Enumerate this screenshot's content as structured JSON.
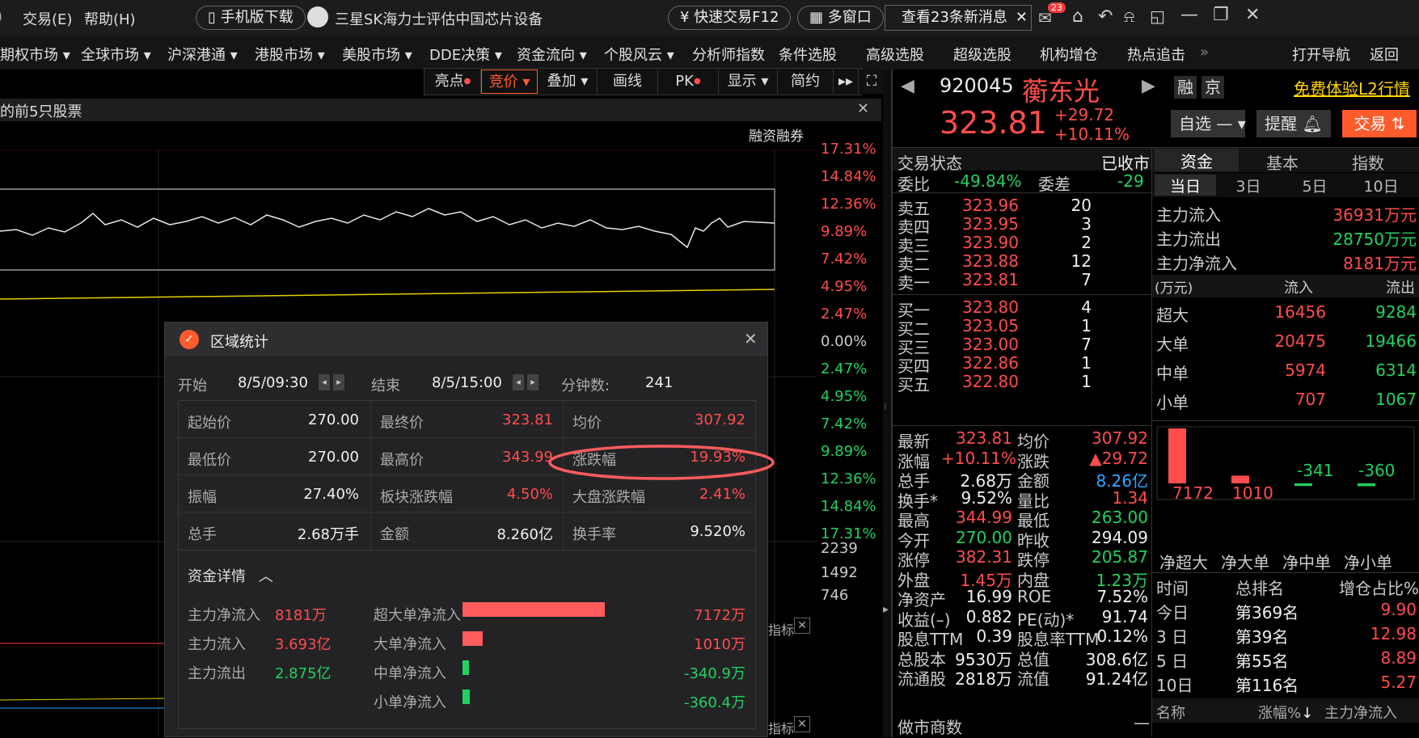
{
  "titlebar": {
    "menu_trade": "交易(E)",
    "menu_help": "帮助(H)",
    "mobile_download": "手机版下载",
    "news_headline": "三星SK海力士评估中国芯片设备",
    "quick_trade": "快速交易F12",
    "multi_window": "多窗口",
    "new_messages": "查看23条新消息",
    "mail_badge": "23"
  },
  "menubar": {
    "items": [
      "期权市场",
      "全球市场",
      "沪深港通",
      "港股市场",
      "美股市场",
      "DDE决策",
      "资金流向",
      "个股风云",
      "分析师指数",
      "条件选股",
      "高级选股",
      "超级选股",
      "机构增仓",
      "热点追击"
    ],
    "open_nav": "打开导航",
    "back": "返回"
  },
  "toolbar": {
    "highlights": "亮点",
    "bidding": "竞价",
    "overlay": "叠加",
    "draw": "画线",
    "pk": "PK",
    "display": "显示",
    "simple": "简约"
  },
  "chart": {
    "banner": "的前5只股票",
    "margin_label": "融资融券",
    "pct_labels_up": [
      "17.31%",
      "14.84%",
      "12.36%",
      "9.89%",
      "7.42%",
      "4.95%",
      "2.47%"
    ],
    "pct_zero": "0.00%",
    "pct_labels_down": [
      "2.47%",
      "4.95%",
      "7.42%",
      "9.89%",
      "12.36%",
      "14.84%",
      "17.31%"
    ],
    "vol_labels": [
      "2239",
      "1492",
      "746"
    ],
    "indicator_label": "指标"
  },
  "dialog": {
    "title": "区域统计",
    "start_label": "开始",
    "start_value": "8/5/09:30",
    "end_label": "结束",
    "end_value": "8/5/15:00",
    "minutes_label": "分钟数:",
    "minutes_value": "241",
    "grid": [
      [
        {
          "label": "起始价",
          "value": "270.00",
          "color": "white"
        },
        {
          "label": "最终价",
          "value": "323.81",
          "color": "red"
        },
        {
          "label": "均价",
          "value": "307.92",
          "color": "red"
        }
      ],
      [
        {
          "label": "最低价",
          "value": "270.00",
          "color": "white"
        },
        {
          "label": "最高价",
          "value": "343.99",
          "color": "red"
        },
        {
          "label": "涨跌幅",
          "value": "19.93%",
          "color": "red"
        }
      ],
      [
        {
          "label": "振幅",
          "value": "27.40%",
          "color": "white"
        },
        {
          "label": "板块涨跌幅",
          "value": "4.50%",
          "color": "red"
        },
        {
          "label": "大盘涨跌幅",
          "value": "2.41%",
          "color": "red"
        }
      ],
      [
        {
          "label": "总手",
          "value": "2.68万手",
          "color": "white"
        },
        {
          "label": "金额",
          "value": "8.260亿",
          "color": "white"
        },
        {
          "label": "换手率",
          "value": "9.520%",
          "color": "white"
        }
      ]
    ],
    "fund_details_label": "资金详情",
    "fund_left": [
      {
        "label": "主力净流入",
        "value": "8181万",
        "color": "red"
      },
      {
        "label": "主力流入",
        "value": "3.693亿",
        "color": "red"
      },
      {
        "label": "主力流出",
        "value": "2.875亿",
        "color": "green"
      }
    ],
    "fund_bars": [
      {
        "label": "超大单净流入",
        "value": "7172万",
        "amount": 7172,
        "color": "red"
      },
      {
        "label": "大单净流入",
        "value": "1010万",
        "amount": 1010,
        "color": "red"
      },
      {
        "label": "中单净流入",
        "value": "-340.9万",
        "amount": -340.9,
        "color": "green"
      },
      {
        "label": "小单净流入",
        "value": "-360.4万",
        "amount": -360.4,
        "color": "green"
      }
    ]
  },
  "stock": {
    "code": "920045",
    "name": "蘅东光",
    "price": "323.81",
    "change": "+29.72",
    "change_pct": "+10.11%",
    "tag_margin": "融",
    "tag_exchange": "京",
    "l2_link": "免费体验L2行情",
    "watchlist": "自选",
    "alert": "提醒",
    "trade": "交易"
  },
  "orderbook": {
    "status_label": "交易状态",
    "status_value": "已收市",
    "ratio_label": "委比",
    "ratio_value": "-49.84%",
    "diff_label": "委差",
    "diff_value": "-29",
    "asks": [
      {
        "label": "卖五",
        "price": "323.96",
        "vol": "20"
      },
      {
        "label": "卖四",
        "price": "323.95",
        "vol": "3"
      },
      {
        "label": "卖三",
        "price": "323.90",
        "vol": "2"
      },
      {
        "label": "卖二",
        "price": "323.88",
        "vol": "12"
      },
      {
        "label": "卖一",
        "price": "323.81",
        "vol": "7"
      }
    ],
    "bids": [
      {
        "label": "买一",
        "price": "323.80",
        "vol": "4"
      },
      {
        "label": "买二",
        "price": "323.05",
        "vol": "1"
      },
      {
        "label": "买三",
        "price": "323.00",
        "vol": "7"
      },
      {
        "label": "买四",
        "price": "322.86",
        "vol": "1"
      },
      {
        "label": "买五",
        "price": "322.80",
        "vol": "1"
      }
    ]
  },
  "quote": [
    {
      "l1": "最新",
      "v1": "323.81",
      "c1": "red",
      "l2": "均价",
      "v2": "307.92",
      "c2": "red"
    },
    {
      "l1": "涨幅",
      "v1": "+10.11%",
      "c1": "red",
      "l2": "涨跌",
      "v2": "▲29.72",
      "c2": "red"
    },
    {
      "l1": "总手",
      "v1": "2.68万",
      "c1": "white",
      "l2": "金额",
      "v2": "8.26亿",
      "c2": "blue"
    },
    {
      "l1": "换手*",
      "v1": "9.52%",
      "c1": "white",
      "l2": "量比",
      "v2": "1.34",
      "c2": "red"
    },
    {
      "l1": "最高",
      "v1": "344.99",
      "c1": "red",
      "l2": "最低",
      "v2": "263.00",
      "c2": "green"
    },
    {
      "l1": "今开",
      "v1": "270.00",
      "c1": "green",
      "l2": "昨收",
      "v2": "294.09",
      "c2": "white"
    },
    {
      "l1": "涨停",
      "v1": "382.31",
      "c1": "red",
      "l2": "跌停",
      "v2": "205.87",
      "c2": "green"
    },
    {
      "l1": "外盘",
      "v1": "1.45万",
      "c1": "red",
      "l2": "内盘",
      "v2": "1.23万",
      "c2": "green"
    },
    {
      "l1": "净资产",
      "v1": "16.99",
      "c1": "white",
      "l2": "ROE",
      "v2": "7.52%",
      "c2": "white"
    },
    {
      "l1": "收益(–)",
      "v1": "0.882",
      "c1": "white",
      "l2": "PE(动)*",
      "v2": "91.74",
      "c2": "white"
    },
    {
      "l1": "股息TTM",
      "v1": "0.39",
      "c1": "white",
      "l2": "股息率TTM",
      "v2": "0.12%",
      "c2": "white"
    },
    {
      "l1": "总股本",
      "v1": "9530万",
      "c1": "white",
      "l2": "总值",
      "v2": "308.6亿",
      "c2": "white"
    },
    {
      "l1": "流通股",
      "v1": "2818万",
      "c1": "white",
      "l2": "流值",
      "v2": "91.24亿",
      "c2": "white"
    }
  ],
  "market_maker": "做市商数",
  "fund": {
    "tabs": [
      "资金",
      "基本",
      "指数"
    ],
    "periods": [
      "当日",
      "3日",
      "5日",
      "10日"
    ],
    "main_in_label": "主力流入",
    "main_in_value": "36931万元",
    "main_out_label": "主力流出",
    "main_out_value": "28750万元",
    "main_net_label": "主力净流入",
    "main_net_value": "8181万元",
    "unit": "(万元)",
    "in_label": "流入",
    "out_label": "流出",
    "rows": [
      {
        "label": "超大",
        "in": "16456",
        "out": "9284"
      },
      {
        "label": "大单",
        "in": "20475",
        "out": "19466"
      },
      {
        "label": "中单",
        "in": "5974",
        "out": "6314"
      },
      {
        "label": "小单",
        "in": "707",
        "out": "1067"
      }
    ],
    "bars": [
      {
        "value": "7172",
        "amount": 7172
      },
      {
        "value": "1010",
        "amount": 1010
      },
      {
        "value": "-341",
        "amount": -341
      },
      {
        "value": "-360",
        "amount": -360
      }
    ],
    "bar_labels": [
      "净超大",
      "净大单",
      "净中单",
      "净小单"
    ],
    "rank_header": [
      "时间",
      "总排名",
      "增仓占比%"
    ],
    "ranks": [
      {
        "period": "今日",
        "rank": "第369名",
        "pct": "9.90"
      },
      {
        "period": "3 日",
        "rank": "第39名",
        "pct": "12.98"
      },
      {
        "period": "5 日",
        "rank": "第55名",
        "pct": "8.89"
      },
      {
        "period": "10日",
        "rank": "第116名",
        "pct": "5.27"
      }
    ],
    "list_header": [
      "名称",
      "涨幅%",
      "主力净流入"
    ]
  },
  "colors": {
    "up": "#ff4d4d",
    "down": "#23d160",
    "accent": "#ff5c2b",
    "blue": "#2fa8ff"
  }
}
